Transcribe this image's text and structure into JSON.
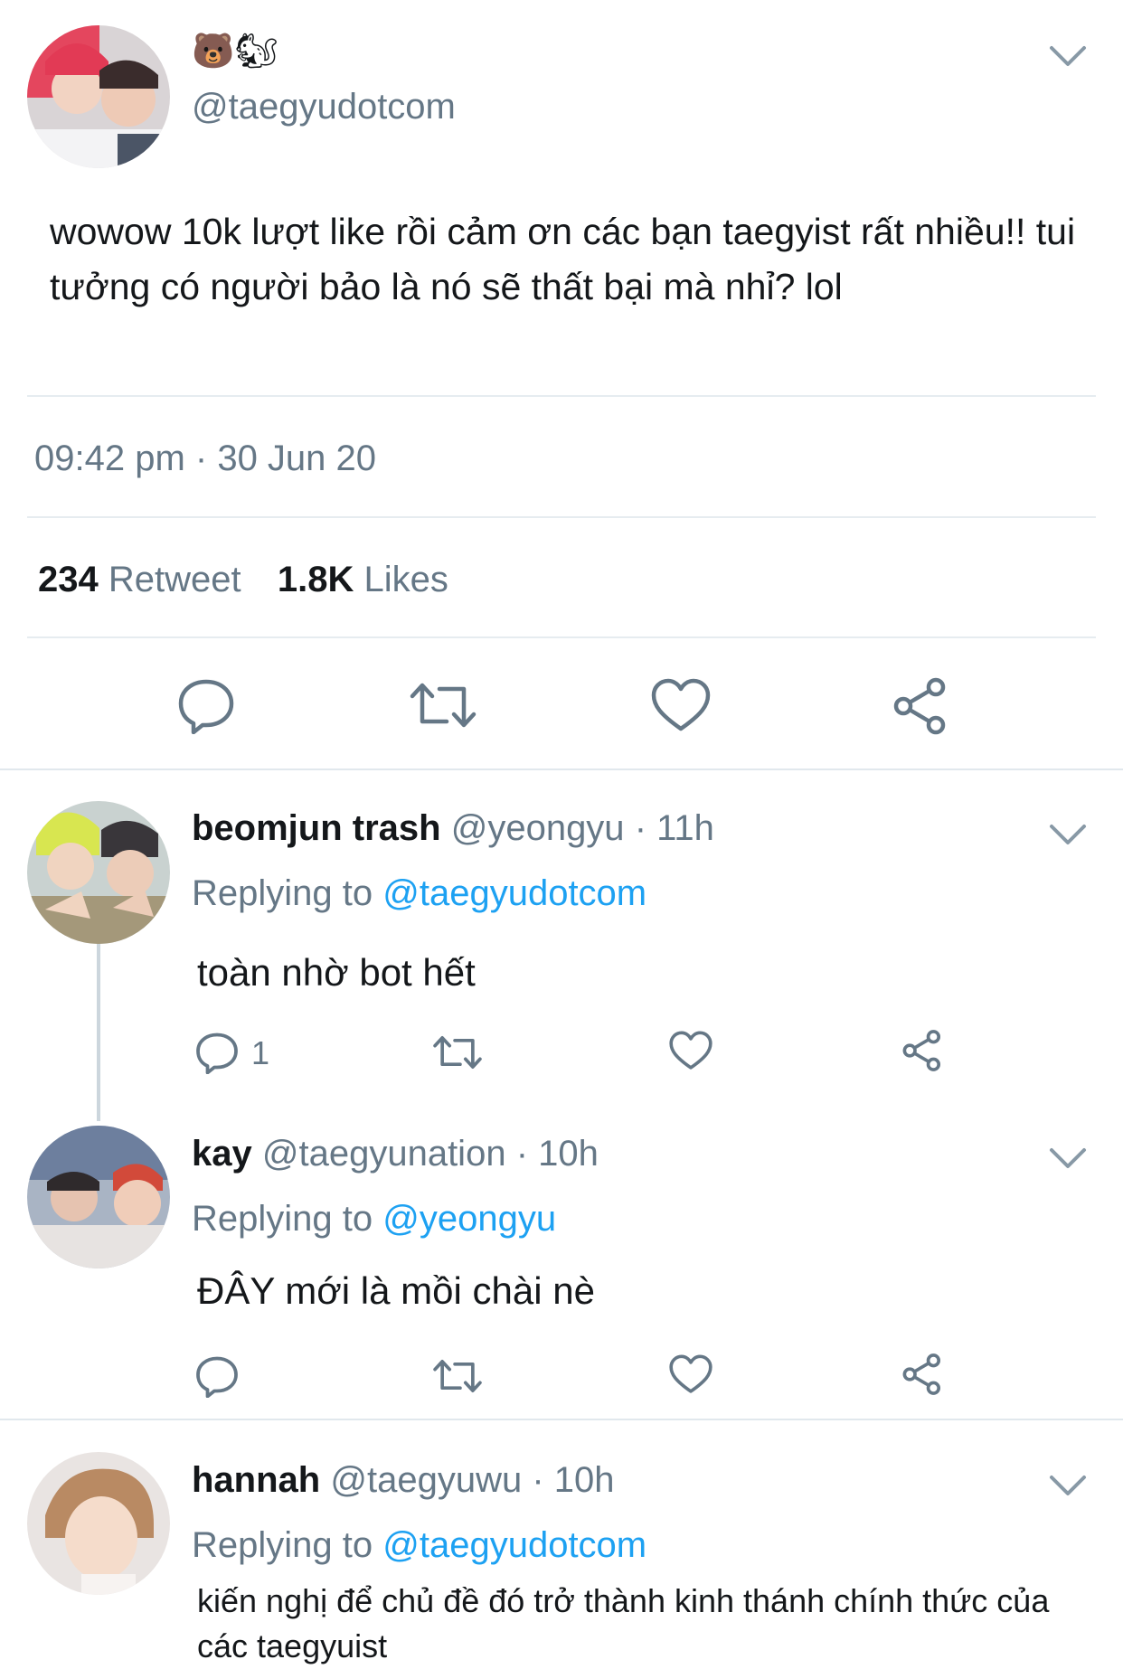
{
  "tweet": {
    "author_emojis": "🐻🐿",
    "handle": "@taegyudotcom",
    "text": "wowow 10k lượt like rồi cảm ơn các bạn taegyist rất nhiều!! tui tưởng có người bảo là nó sẽ thất bại mà nhỉ? lol",
    "timestamp": "09:42 pm · 30 Jun 20",
    "retweet_count": "234",
    "retweet_label": "Retweet",
    "likes_count": "1.8K",
    "likes_label": "Likes"
  },
  "replies": [
    {
      "name": "beomjun trash",
      "handle": "@yeongyu",
      "time": "· 11h",
      "replying_label": "Replying to",
      "replying_to": "@taegyudotcom",
      "text": "toàn nhờ bot hết",
      "reply_count": "1"
    },
    {
      "name": "kay",
      "handle": "@taegyunation",
      "time": "· 10h",
      "replying_label": "Replying to",
      "replying_to": "@yeongyu",
      "text": "ĐÂY mới là mồi chài nè",
      "reply_count": ""
    },
    {
      "name": "hannah",
      "handle": "@taegyuwu",
      "time": "· 10h",
      "replying_label": "Replying to",
      "replying_to": "@taegyudotcom",
      "text": "kiến nghị để chủ đề đó trở thành kinh thánh chính thức của các taegyuist",
      "reply_count": ""
    }
  ],
  "colors": {
    "accent": "#1da1f2",
    "muted": "#657786",
    "icon": "#657786",
    "divider": "#e6ecf0"
  },
  "icons": [
    "chevron-down-icon",
    "reply-icon",
    "retweet-icon",
    "like-icon",
    "share-icon"
  ]
}
